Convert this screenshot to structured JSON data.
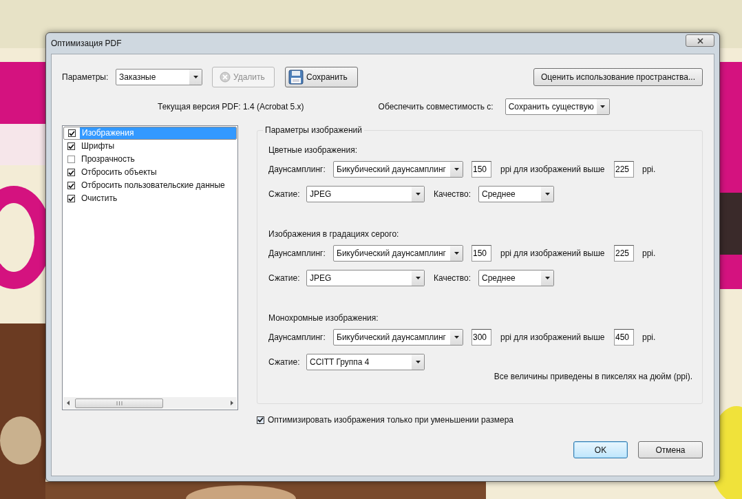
{
  "window": {
    "title": "Оптимизация PDF"
  },
  "params": {
    "label": "Параметры:",
    "value": "Заказные"
  },
  "delete_button": {
    "label": "Удалить",
    "disabled": true
  },
  "save_button": {
    "label": "Сохранить"
  },
  "estimate_button": {
    "label": "Оценить использование пространства..."
  },
  "current_version": "Текущая версия PDF: 1.4 (Acrobat 5.x)",
  "compat": {
    "label": "Обеспечить совместимость с:",
    "value": "Сохранить существую"
  },
  "categories": [
    {
      "label": "Изображения",
      "checked": true,
      "selected": true
    },
    {
      "label": "Шрифты",
      "checked": true,
      "selected": false
    },
    {
      "label": "Прозрачность",
      "checked": false,
      "selected": false
    },
    {
      "label": "Отбросить объекты",
      "checked": true,
      "selected": false
    },
    {
      "label": "Отбросить пользовательские данные",
      "checked": true,
      "selected": false
    },
    {
      "label": "Очистить",
      "checked": true,
      "selected": false
    }
  ],
  "panel": {
    "title": "Параметры изображений",
    "sections": [
      {
        "title": "Цветные изображения:",
        "downsampling": {
          "label": "Даунсамплинг:",
          "value": "Бикубический даунсамплинг",
          "ppi": "150",
          "above_label": "ppi для изображений выше",
          "above_value": "225",
          "unit": "ppi."
        },
        "compression": {
          "label": "Сжатие:",
          "value": "JPEG"
        },
        "quality": {
          "label": "Качество:",
          "value": "Среднее"
        }
      },
      {
        "title": "Изображения в градациях серого:",
        "downsampling": {
          "label": "Даунсамплинг:",
          "value": "Бикубический даунсамплинг",
          "ppi": "150",
          "above_label": "ppi для изображений выше",
          "above_value": "225",
          "unit": "ppi."
        },
        "compression": {
          "label": "Сжатие:",
          "value": "JPEG"
        },
        "quality": {
          "label": "Качество:",
          "value": "Среднее"
        }
      },
      {
        "title": "Монохромные изображения:",
        "downsampling": {
          "label": "Даунсамплинг:",
          "value": "Бикубический даунсамплинг",
          "ppi": "300",
          "above_label": "ppi для изображений выше",
          "above_value": "450",
          "unit": "ppi."
        },
        "compression": {
          "label": "Сжатие:",
          "value": "CCITT Группа 4"
        }
      }
    ],
    "note": "Все величины приведены в пикселях на дюйм (ppi)."
  },
  "optimize_only_smaller": {
    "label": "Оптимизировать изображения только при уменьшении размера",
    "checked": true
  },
  "buttons": [
    {
      "label": "OK",
      "default": true
    },
    {
      "label": "Отмена",
      "default": false
    }
  ]
}
